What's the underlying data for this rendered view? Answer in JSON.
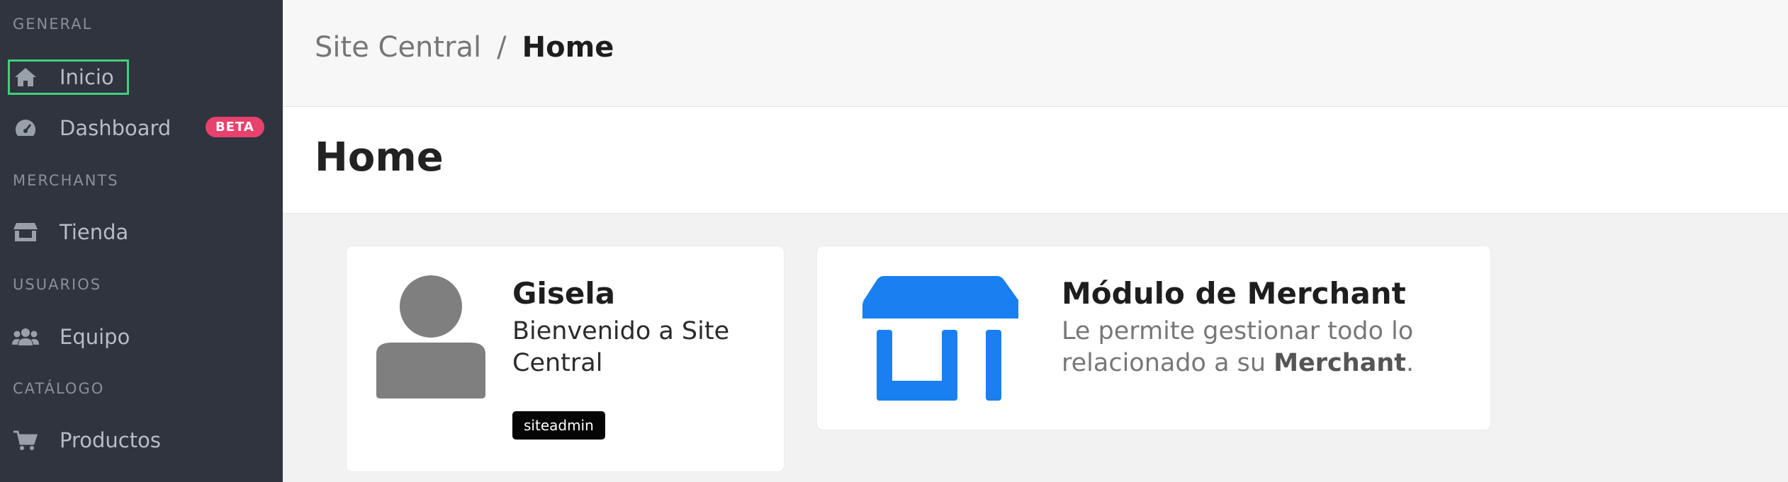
{
  "sidebar": {
    "sections": [
      {
        "title": "GENERAL"
      },
      {
        "title": "MERCHANTS"
      },
      {
        "title": "USUARIOS"
      },
      {
        "title": "CATÁLOGO"
      }
    ],
    "items": [
      {
        "label": "Inicio",
        "icon": "home-icon"
      },
      {
        "label": "Dashboard",
        "icon": "dashboard-icon",
        "badge": "BETA"
      },
      {
        "label": "Tienda",
        "icon": "store-icon"
      },
      {
        "label": "Equipo",
        "icon": "team-icon"
      },
      {
        "label": "Productos",
        "icon": "cart-icon"
      }
    ]
  },
  "breadcrumb": {
    "parent": "Site Central",
    "separator": "/",
    "current": "Home"
  },
  "page": {
    "title": "Home"
  },
  "user_card": {
    "name": "Gisela",
    "welcome": "Bienvenido a Site Central",
    "role": "siteadmin"
  },
  "merchant_card": {
    "title": "Módulo de Merchant",
    "desc_prefix": "Le permite gestionar todo lo relacionado a su ",
    "desc_bold": "Merchant",
    "desc_suffix": "."
  },
  "colors": {
    "sidebar_bg": "#2f343e",
    "accent_blue": "#1a7ff0",
    "beta_badge": "#e8416d",
    "active_outline": "#40d07a"
  }
}
